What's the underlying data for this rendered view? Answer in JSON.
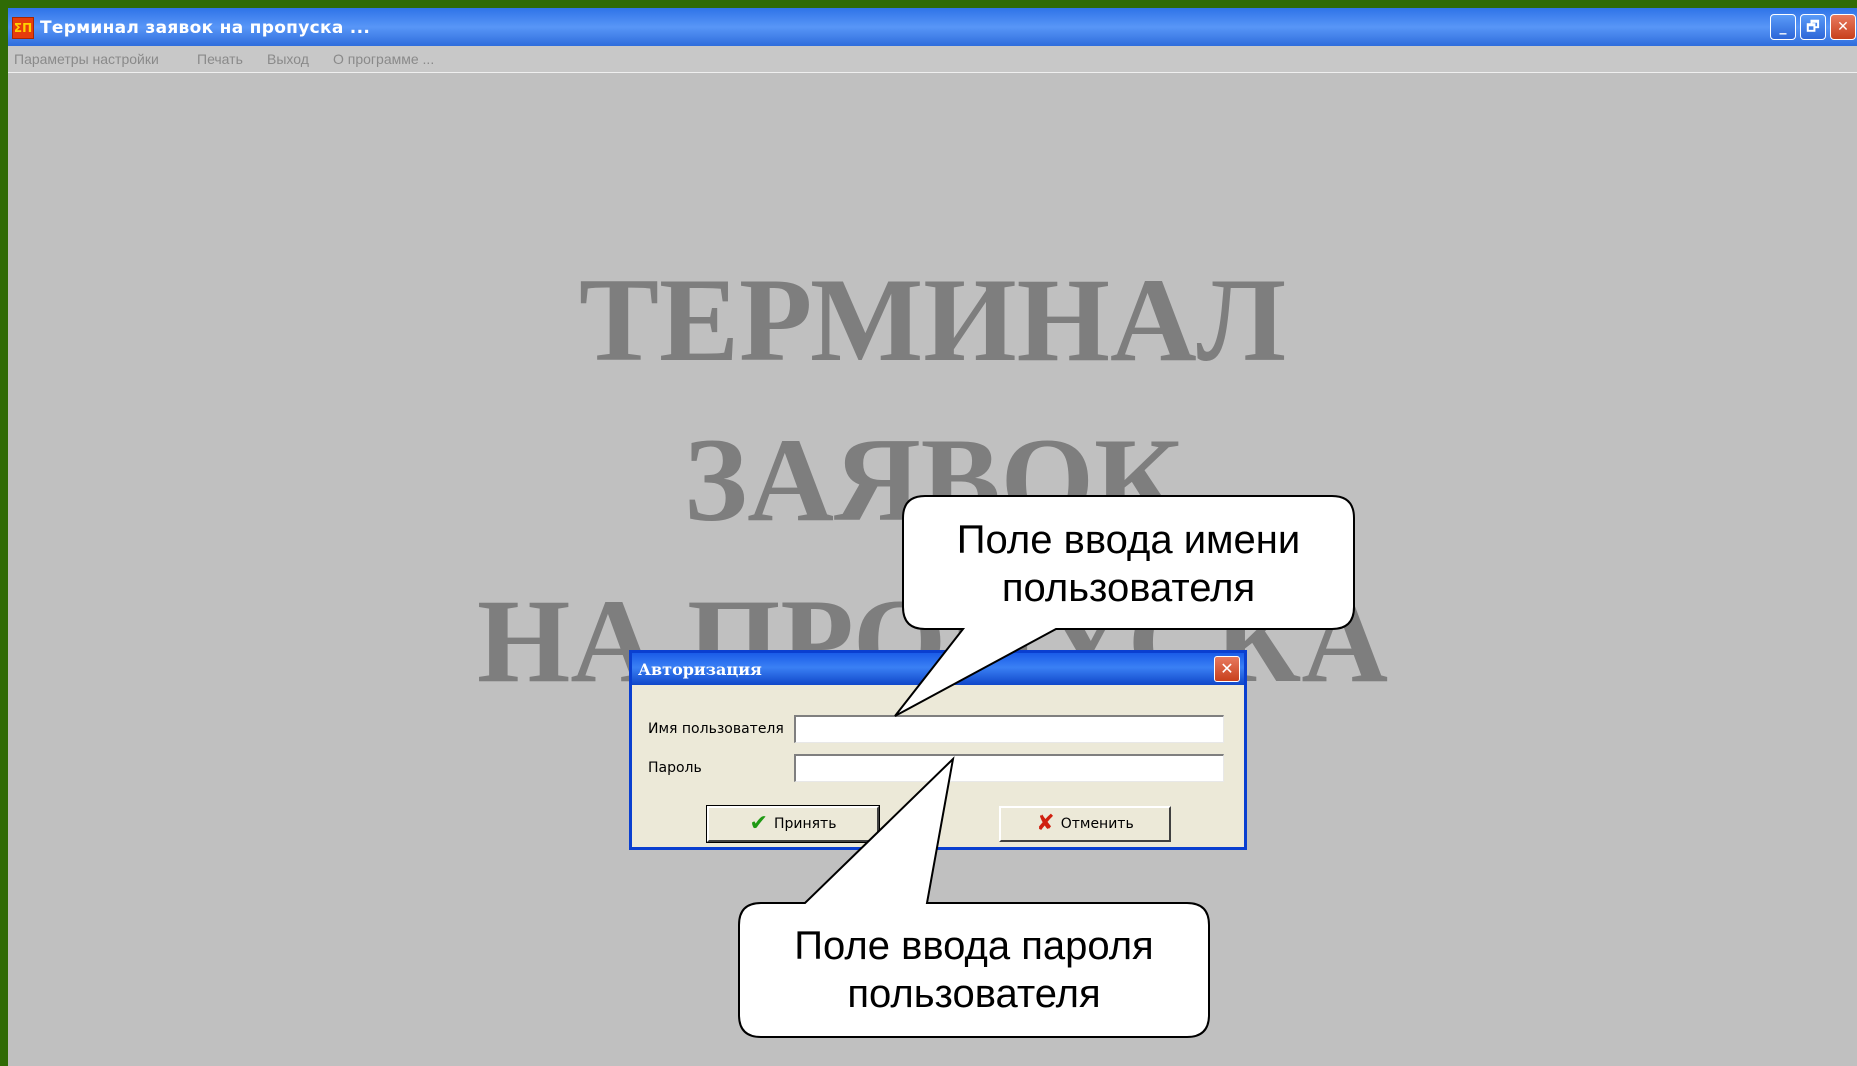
{
  "window": {
    "title": "Терминал заявок на пропуска ...",
    "app_icon": "ΣΠ",
    "controls": {
      "minimize": "_",
      "maximize": "🗗",
      "close": "✕"
    }
  },
  "menu": {
    "items": [
      "Параметры настройки",
      "Печать",
      "Выход",
      "О программе ..."
    ]
  },
  "background_title": {
    "line1": "ТЕРМИНАЛ",
    "line2": "ЗАЯВОК",
    "line3": "НА ПРОПУСКА"
  },
  "dialog": {
    "title": "Авторизация",
    "close": "✕",
    "username_label": "Имя пользователя",
    "username_value": "",
    "password_label": "Пароль",
    "password_value": "",
    "ok_label": "Принять",
    "ok_icon": "check-icon",
    "cancel_label": "Отменить",
    "cancel_icon": "x-icon"
  },
  "callouts": {
    "username_line1": "Поле ввода имени",
    "username_line2": "пользователя",
    "password_line1": "Поле ввода пароля",
    "password_line2": "пользователя"
  },
  "colors": {
    "desktop": "#2f6b05",
    "workspace": "#c0c0c0",
    "titlebar": "#3a7ff0",
    "dialog_border": "#0a3fd0"
  }
}
